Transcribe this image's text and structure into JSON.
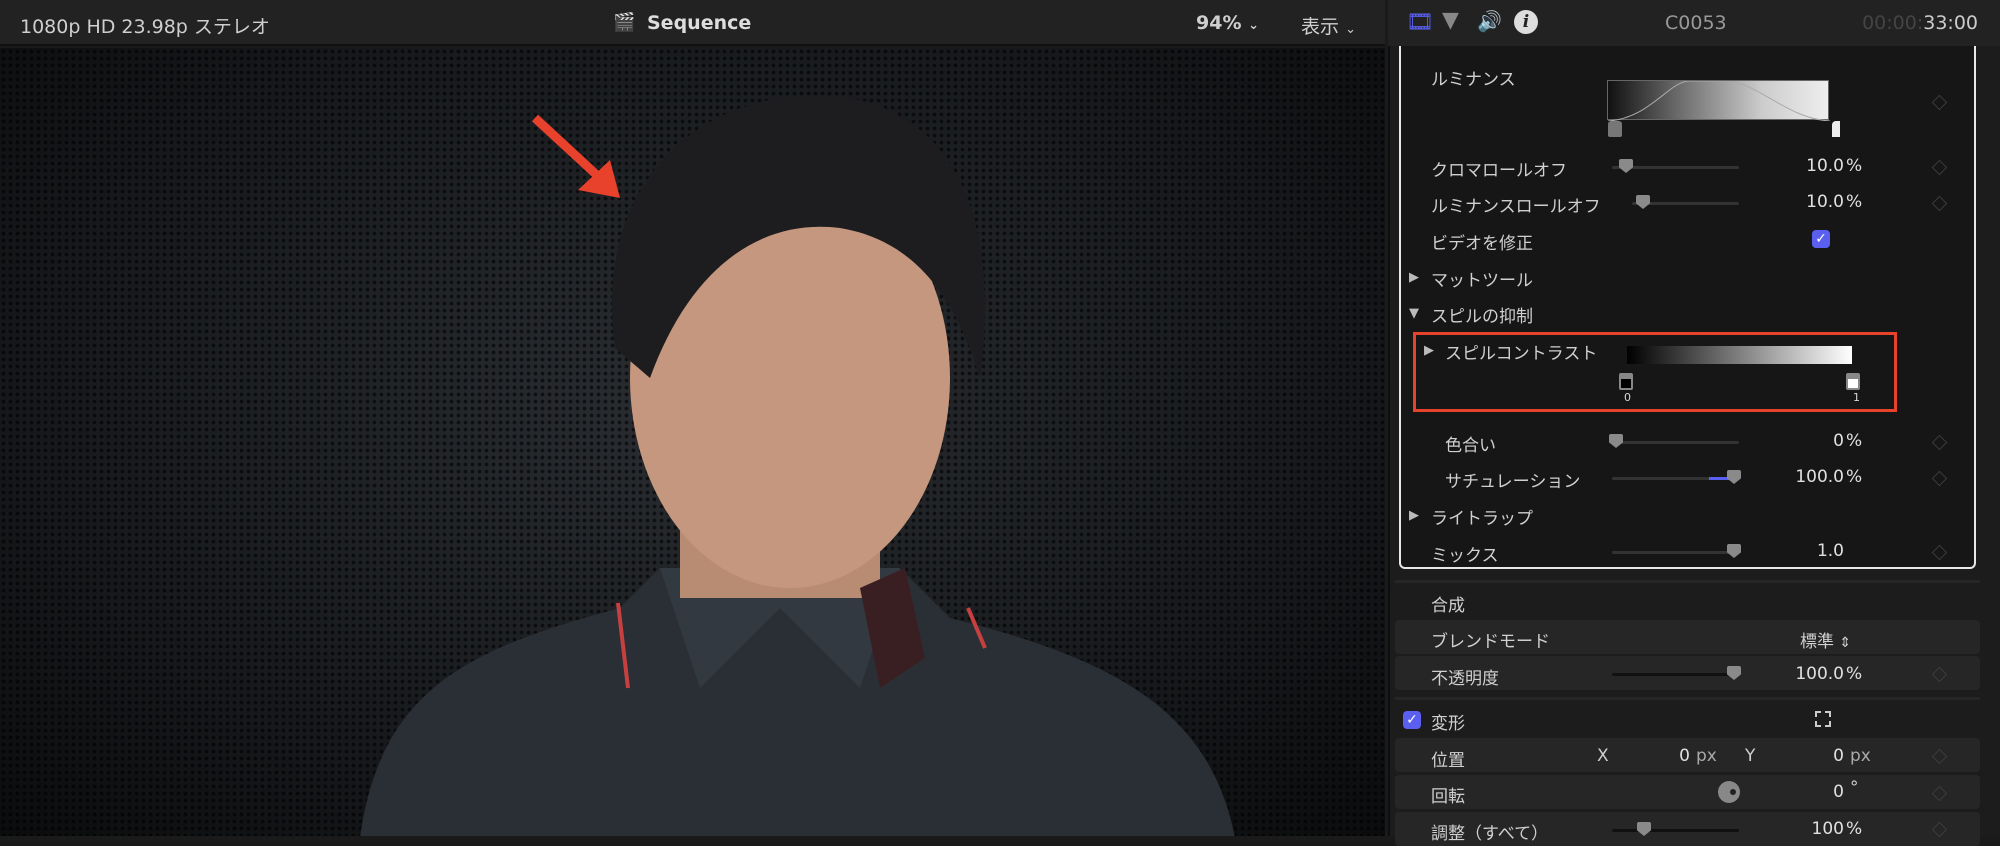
{
  "viewer": {
    "format": "1080p HD 23.98p ステレオ",
    "title": "Sequence",
    "zoom": "94%",
    "view_menu": "表示"
  },
  "inspector": {
    "clip_name": "C0053",
    "timecode_dim": "00:00:",
    "timecode": "33:00",
    "keyer": {
      "luminance": "ルミナンス",
      "chroma_rolloff": {
        "label": "クロマロールオフ",
        "value": "10.0",
        "unit": "%",
        "fraction": 0.1
      },
      "luma_rolloff": {
        "label": "ルミナンスロールオフ",
        "value": "10.0",
        "unit": "%",
        "fraction": 0.1
      },
      "fix_video": {
        "label": "ビデオを修正",
        "checked": true
      },
      "matte_tools": "マットツール",
      "spill_suppression": "スピルの抑制",
      "spill_contrast": {
        "label": "スピルコントラスト",
        "min_label": "0",
        "max_label": "1"
      },
      "tint": {
        "label": "色合い",
        "value": "0",
        "unit": "%",
        "fraction": 0
      },
      "saturation": {
        "label": "サチュレーション",
        "value": "100.0",
        "unit": "%",
        "fraction": 1
      },
      "light_wrap": "ライトラップ",
      "mix": {
        "label": "ミックス",
        "value": "1.0",
        "fraction": 1
      }
    },
    "compositing": {
      "title": "合成",
      "blend_mode_label": "ブレンドモード",
      "blend_mode": "標準",
      "opacity_label": "不透明度",
      "opacity": "100.0",
      "opacity_unit": "%"
    },
    "transform": {
      "title": "変形",
      "checked": true,
      "position_label": "位置",
      "x_label": "X",
      "x": "0",
      "y_label": "Y",
      "y": "0",
      "px": "px",
      "rotation_label": "回転",
      "rotation": "0",
      "deg": "°",
      "scale_label": "調整（すべて）",
      "scale": "100",
      "scale_unit": "%"
    }
  },
  "colors": {
    "accent": "#5a5ff0",
    "highlight": "#e8412c"
  }
}
